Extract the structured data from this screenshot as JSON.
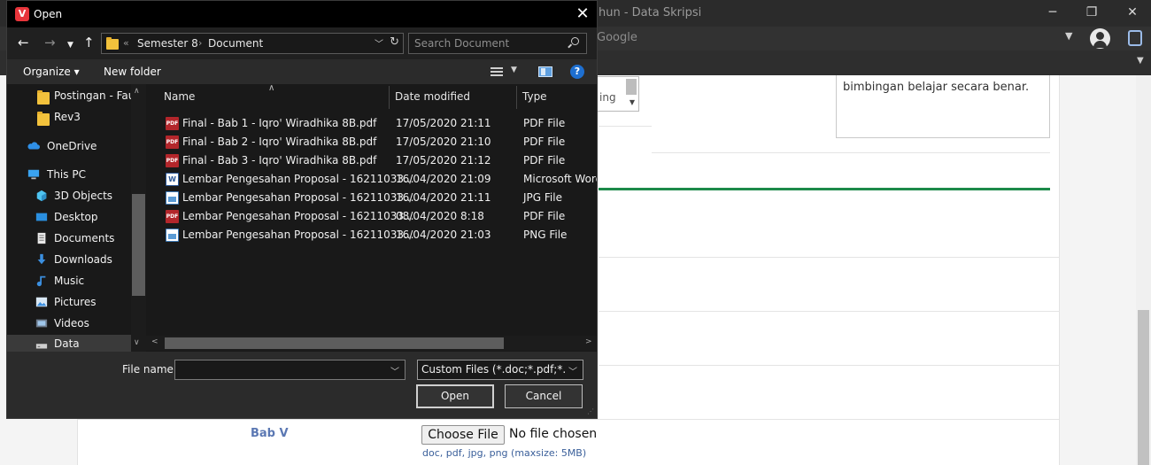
{
  "browser": {
    "window_title": "hun - Data Skripsi",
    "address_text": "Google",
    "minimize": "─",
    "maximize": "❐",
    "close": "✕"
  },
  "page": {
    "select_fragment": "ing",
    "textbox_text": "bimbingan belajar secara benar.",
    "bab_label": "Bab V",
    "choose_file_label": "Choose File",
    "no_file_text": "No file chosen",
    "hint_text": "doc, pdf, jpg, png (maxsize: 5MB)"
  },
  "dialog": {
    "title": "Open",
    "app_icon_letter": "V",
    "breadcrumb": [
      "«",
      "Semester 8",
      "Document"
    ],
    "search_placeholder": "Search Document",
    "toolbar": {
      "organize": "Organize ▾",
      "new_folder": "New folder"
    },
    "nav_items": [
      {
        "label": "Postingan - Fauc",
        "icon": "folder-icon"
      },
      {
        "label": "Rev3",
        "icon": "folder-icon"
      },
      {
        "label": "OneDrive",
        "icon": "cloud-icon"
      },
      {
        "label": "This PC",
        "icon": "computer-icon"
      },
      {
        "label": "3D Objects",
        "icon": "cube-icon"
      },
      {
        "label": "Desktop",
        "icon": "desktop-icon"
      },
      {
        "label": "Documents",
        "icon": "document-icon"
      },
      {
        "label": "Downloads",
        "icon": "download-icon"
      },
      {
        "label": "Music",
        "icon": "music-icon"
      },
      {
        "label": "Pictures",
        "icon": "picture-icon"
      },
      {
        "label": "Videos",
        "icon": "video-icon"
      },
      {
        "label": "Data",
        "icon": "drive-icon"
      }
    ],
    "columns": {
      "name": "Name",
      "date": "Date modified",
      "type": "Type"
    },
    "files": [
      {
        "name": "Final - Bab 1 - Iqro' Wiradhika 8B.pdf",
        "date": "17/05/2020 21:11",
        "type": "PDF File",
        "icon": "pdf"
      },
      {
        "name": "Final - Bab 2 - Iqro' Wiradhika 8B.pdf",
        "date": "17/05/2020 21:10",
        "type": "PDF File",
        "icon": "pdf"
      },
      {
        "name": "Final - Bab 3 - Iqro' Wiradhika 8B.pdf",
        "date": "17/05/2020 21:12",
        "type": "PDF File",
        "icon": "pdf"
      },
      {
        "name": "Lembar Pengesahan Proposal - 16211033...",
        "date": "16/04/2020 21:09",
        "type": "Microsoft Word",
        "icon": "word"
      },
      {
        "name": "Lembar Pengesahan Proposal - 16211033...",
        "date": "16/04/2020 21:11",
        "type": "JPG File",
        "icon": "image"
      },
      {
        "name": "Lembar Pengesahan Proposal - 16211033...",
        "date": "08/04/2020 8:18",
        "type": "PDF File",
        "icon": "pdf"
      },
      {
        "name": "Lembar Pengesahan Proposal - 16211033...",
        "date": "16/04/2020 21:03",
        "type": "PNG File",
        "icon": "image"
      }
    ],
    "file_name_label": "File name:",
    "file_name_value": "",
    "filter_value": "Custom Files (*.doc;*.pdf;*.jpg;",
    "open_label": "Open",
    "cancel_label": "Cancel"
  }
}
